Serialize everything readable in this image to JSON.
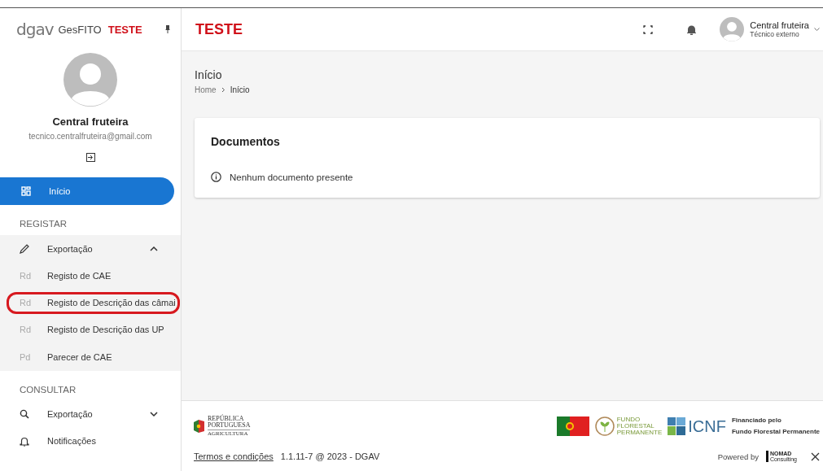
{
  "sidebar": {
    "logo": "dgav",
    "app_name": "GesFITO",
    "env_badge": "TESTE",
    "user_name": "Central fruteira",
    "user_email": "tecnico.centralfruteira@gmail.com",
    "home": {
      "label": "Início",
      "selected": true
    },
    "sections": [
      {
        "title": "REGISTAR",
        "groups": [
          {
            "label": "Exportação",
            "kind": "edit",
            "expanded": true,
            "children": [
              {
                "abbr": "Rd",
                "label": "Registo de CAE",
                "annotated": false
              },
              {
                "abbr": "Rd",
                "label": "Registo de Descrição das câmai",
                "annotated": true
              },
              {
                "abbr": "Rd",
                "label": "Registo de Descrição das UP",
                "annotated": false
              },
              {
                "abbr": "Pd",
                "label": "Parecer de CAE",
                "annotated": false
              }
            ]
          }
        ]
      },
      {
        "title": "CONSULTAR",
        "groups": [
          {
            "label": "Exportação",
            "kind": "search",
            "expanded": false
          },
          {
            "label": "Notificações",
            "kind": "notifications"
          }
        ]
      }
    ]
  },
  "header": {
    "title": "TESTE",
    "user_name": "Central fruteira",
    "user_role": "Técnico externo"
  },
  "page": {
    "title": "Início",
    "breadcrumb": [
      "Home",
      "Início"
    ]
  },
  "card": {
    "title": "Documentos",
    "message": "Nenhum documento presente"
  },
  "footer": {
    "gov_logo": [
      "REPÚBLICA",
      "PORTUGUESA",
      "AGRICULTURA"
    ],
    "fund_logo": [
      "FUNDO",
      "FLORESTAL",
      "PERMANENTE"
    ],
    "icnf": "ICNF",
    "funding": [
      "Financiado pelo",
      "Fundo Florestal Permanente"
    ],
    "terms_link": "Termos e condições",
    "version": "1.1.11-7 @ 2023 - DGAV",
    "powered_by": "Powered by",
    "vendor": [
      "NOMAD",
      "Consulting"
    ]
  }
}
